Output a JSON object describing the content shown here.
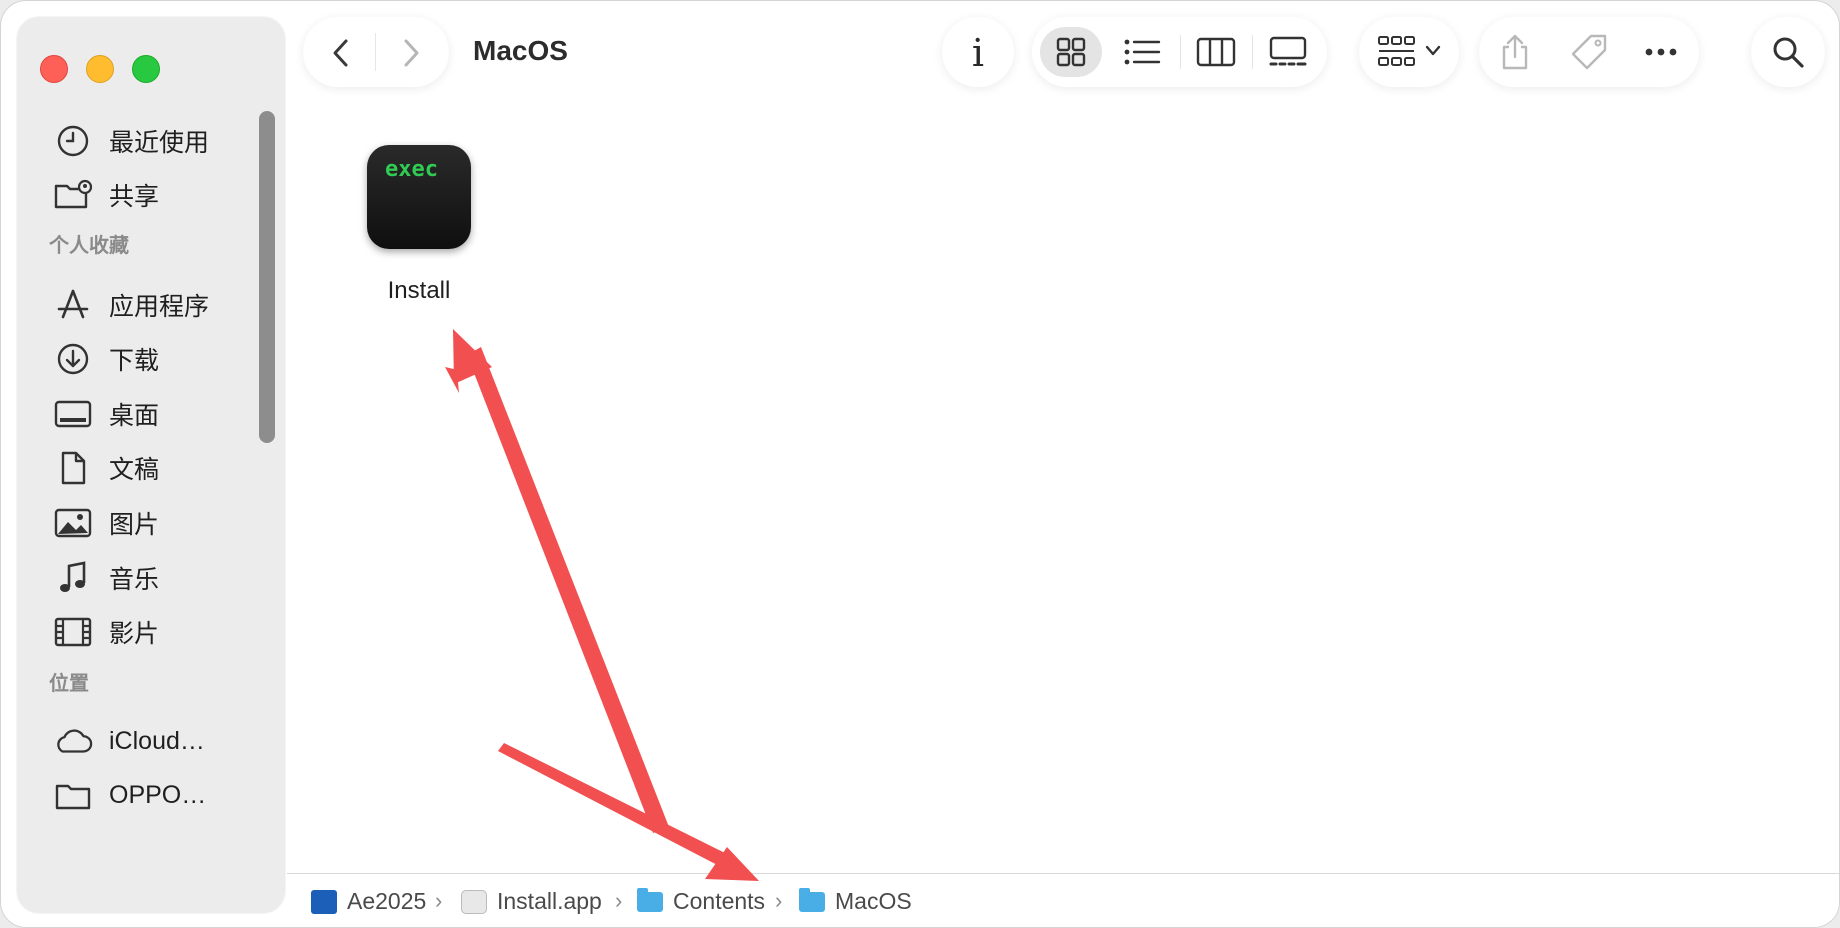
{
  "window": {
    "title": "MacOS"
  },
  "sidebar": {
    "items_top": [
      {
        "label": "最近使用",
        "icon": "clock-icon"
      },
      {
        "label": "共享",
        "icon": "shared-folder-icon"
      }
    ],
    "favorites_header": "个人收藏",
    "favorites": [
      {
        "label": "应用程序",
        "icon": "app-store-icon"
      },
      {
        "label": "下载",
        "icon": "download-icon"
      },
      {
        "label": "桌面",
        "icon": "desktop-icon"
      },
      {
        "label": "文稿",
        "icon": "document-icon"
      },
      {
        "label": "图片",
        "icon": "photo-icon"
      },
      {
        "label": "音乐",
        "icon": "music-icon"
      },
      {
        "label": "影片",
        "icon": "film-icon"
      }
    ],
    "locations_header": "位置",
    "locations": [
      {
        "label": "iCloud…",
        "icon": "cloud-icon"
      },
      {
        "label": "OPPO…",
        "icon": "folder-icon"
      }
    ]
  },
  "toolbar": {
    "info_glyph": "i",
    "active_view": "icon-view"
  },
  "content": {
    "files": [
      {
        "name": "Install",
        "icon_text": "exec",
        "icon": "exec-icon"
      }
    ]
  },
  "pathbar": {
    "crumbs": [
      {
        "label": "Ae2025",
        "icon": "ae-icon"
      },
      {
        "label": "Install.app",
        "icon": "app-icon"
      },
      {
        "label": "Contents",
        "icon": "folder-icon"
      },
      {
        "label": "MacOS",
        "icon": "folder-icon"
      }
    ],
    "separator": "›"
  },
  "annotations": {
    "arrow_color": "#f25050"
  }
}
